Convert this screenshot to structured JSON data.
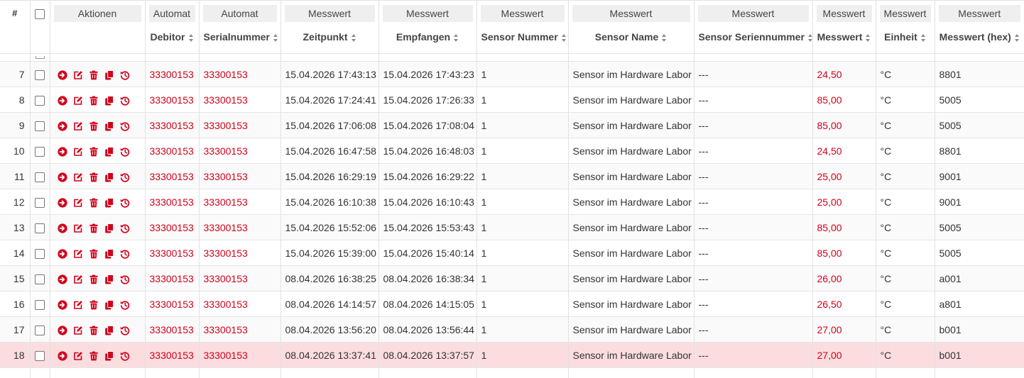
{
  "header": {
    "num_label": "#",
    "groups": {
      "aktionen": "Aktionen",
      "debitor": "Automat",
      "serial": "Automat",
      "zeitpunkt": "Messwert",
      "empfangen": "Messwert",
      "sensor_nummer": "Messwert",
      "sensor_name": "Messwert",
      "sensor_serial": "Messwert",
      "messwert": "Messwert",
      "einheit": "Messwert",
      "hex": "Messwert"
    },
    "columns": {
      "debitor": "Debitor",
      "serial": "Serialnummer",
      "zeitpunkt": "Zeitpunkt",
      "empfangen": "Empfangen",
      "sensor_nummer": "Sensor Nummer",
      "sensor_name": "Sensor Name",
      "sensor_serial": "Sensor Seriennummer",
      "messwert": "Messwert",
      "einheit": "Einheit",
      "hex": "Messwert (hex)"
    }
  },
  "icons": [
    "arrow-right-circle-icon",
    "edit-icon",
    "trash-icon",
    "copy-icon",
    "history-icon"
  ],
  "colors": {
    "accent": "#d0021b",
    "selected_row": "#fbdde0"
  },
  "rows": [
    {
      "num": "7",
      "debitor": "33300153",
      "serial": "33300153",
      "zeitpunkt": "15.04.2026 17:43:13",
      "empfangen": "15.04.2026 17:43:23",
      "sensor_nummer": "1",
      "sensor_name": "Sensor im Hardware Labor",
      "sensor_serial": "---",
      "messwert": "24,50",
      "einheit": "°C",
      "hex": "8801"
    },
    {
      "num": "8",
      "debitor": "33300153",
      "serial": "33300153",
      "zeitpunkt": "15.04.2026 17:24:41",
      "empfangen": "15.04.2026 17:26:33",
      "sensor_nummer": "1",
      "sensor_name": "Sensor im Hardware Labor",
      "sensor_serial": "---",
      "messwert": "85,00",
      "einheit": "°C",
      "hex": "5005"
    },
    {
      "num": "9",
      "debitor": "33300153",
      "serial": "33300153",
      "zeitpunkt": "15.04.2026 17:06:08",
      "empfangen": "15.04.2026 17:08:04",
      "sensor_nummer": "1",
      "sensor_name": "Sensor im Hardware Labor",
      "sensor_serial": "---",
      "messwert": "85,00",
      "einheit": "°C",
      "hex": "5005"
    },
    {
      "num": "10",
      "debitor": "33300153",
      "serial": "33300153",
      "zeitpunkt": "15.04.2026 16:47:58",
      "empfangen": "15.04.2026 16:48:03",
      "sensor_nummer": "1",
      "sensor_name": "Sensor im Hardware Labor",
      "sensor_serial": "---",
      "messwert": "24,50",
      "einheit": "°C",
      "hex": "8801"
    },
    {
      "num": "11",
      "debitor": "33300153",
      "serial": "33300153",
      "zeitpunkt": "15.04.2026 16:29:19",
      "empfangen": "15.04.2026 16:29:22",
      "sensor_nummer": "1",
      "sensor_name": "Sensor im Hardware Labor",
      "sensor_serial": "---",
      "messwert": "25,00",
      "einheit": "°C",
      "hex": "9001"
    },
    {
      "num": "12",
      "debitor": "33300153",
      "serial": "33300153",
      "zeitpunkt": "15.04.2026 16:10:38",
      "empfangen": "15.04.2026 16:10:43",
      "sensor_nummer": "1",
      "sensor_name": "Sensor im Hardware Labor",
      "sensor_serial": "---",
      "messwert": "25,00",
      "einheit": "°C",
      "hex": "9001"
    },
    {
      "num": "13",
      "debitor": "33300153",
      "serial": "33300153",
      "zeitpunkt": "15.04.2026 15:52:06",
      "empfangen": "15.04.2026 15:53:43",
      "sensor_nummer": "1",
      "sensor_name": "Sensor im Hardware Labor",
      "sensor_serial": "---",
      "messwert": "85,00",
      "einheit": "°C",
      "hex": "5005"
    },
    {
      "num": "14",
      "debitor": "33300153",
      "serial": "33300153",
      "zeitpunkt": "15.04.2026 15:39:00",
      "empfangen": "15.04.2026 15:40:14",
      "sensor_nummer": "1",
      "sensor_name": "Sensor im Hardware Labor",
      "sensor_serial": "---",
      "messwert": "85,00",
      "einheit": "°C",
      "hex": "5005"
    },
    {
      "num": "15",
      "debitor": "33300153",
      "serial": "33300153",
      "zeitpunkt": "08.04.2026 16:38:25",
      "empfangen": "08.04.2026 16:38:34",
      "sensor_nummer": "1",
      "sensor_name": "Sensor im Hardware Labor",
      "sensor_serial": "---",
      "messwert": "26,00",
      "einheit": "°C",
      "hex": "a001"
    },
    {
      "num": "16",
      "debitor": "33300153",
      "serial": "33300153",
      "zeitpunkt": "08.04.2026 14:14:57",
      "empfangen": "08.04.2026 14:15:05",
      "sensor_nummer": "1",
      "sensor_name": "Sensor im Hardware Labor",
      "sensor_serial": "---",
      "messwert": "26,50",
      "einheit": "°C",
      "hex": "a801"
    },
    {
      "num": "17",
      "debitor": "33300153",
      "serial": "33300153",
      "zeitpunkt": "08.04.2026 13:56:20",
      "empfangen": "08.04.2026 13:56:44",
      "sensor_nummer": "1",
      "sensor_name": "Sensor im Hardware Labor",
      "sensor_serial": "---",
      "messwert": "27,00",
      "einheit": "°C",
      "hex": "b001"
    },
    {
      "num": "18",
      "debitor": "33300153",
      "serial": "33300153",
      "zeitpunkt": "08.04.2026 13:37:41",
      "empfangen": "08.04.2026 13:37:57",
      "sensor_nummer": "1",
      "sensor_name": "Sensor im Hardware Labor",
      "sensor_serial": "---",
      "messwert": "27,00",
      "einheit": "°C",
      "hex": "b001",
      "selected": true
    }
  ]
}
